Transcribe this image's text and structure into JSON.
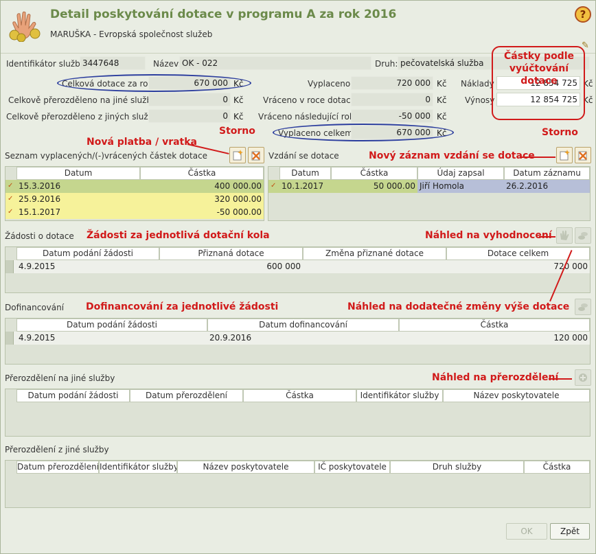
{
  "window": {
    "title": "Detail poskytování dotace v programu A za rok 2016",
    "subtitle": "MARUŠKA - Evropská společnost služeb",
    "help": "?"
  },
  "header_fields": {
    "id_label": "Identifikátor služby:",
    "id_value": "3447648",
    "name_label": "Název:",
    "name_value": "OK - 022",
    "type_label": "Druh:",
    "type_value": "pečovatelská služba"
  },
  "amounts": {
    "celkova_label": "Celková dotace za rok:",
    "celkova_value": "670 000",
    "prerozdeleno_label": "Celkově přerozděleno na jiné služby:",
    "prerozdeleno_value": "0",
    "prerozdeleno_z_label": "Celkově přerozděleno z jiných služeb:",
    "prerozdeleno_z_value": "0",
    "vyplaceno_label": "Vyplaceno:",
    "vyplaceno_value": "720 000",
    "vraceno_label": "Vráceno v roce dotace:",
    "vraceno_value": "0",
    "vraceno_nasl_label": "Vráceno následující rok:",
    "vraceno_nasl_value": "-50 000",
    "vyplaceno_celkem_label": "Vyplaceno celkem:",
    "vyplaceno_celkem_value": "670 000",
    "naklady_label": "Náklady",
    "naklady_value": "12 854 725",
    "vynosy_label": "Výnosy",
    "vynosy_value": "12 854 725",
    "currency": "Kč"
  },
  "annotations": {
    "castky": "Částky podle vyúčtování dotace",
    "nova_platba": "Nová platba / vratka",
    "storno1": "Storno",
    "storno2": "Storno",
    "novy_zaznam": "Nový záznam vzdání se dotace",
    "zadosti": "Žádosti za jednotlivá dotační kola",
    "nahled_vyhodnoceni": "Náhled na vyhodnocení",
    "dofinancovani": "Dofinancování za jednotlivé žádosti",
    "nahled_zmeny": "Náhled na dodatečné změny výše dotace",
    "nahled_prerozdeleni": "Náhled na přerozdělení"
  },
  "payments": {
    "title": "Seznam vyplacených/(-)vrácených částek dotace",
    "columns": [
      "Datum",
      "Částka"
    ],
    "rows": [
      {
        "date": "15.3.2016",
        "amount": "400 000.00"
      },
      {
        "date": "25.9.2016",
        "amount": "320 000.00"
      },
      {
        "date": "15.1.2017",
        "amount": "-50 000.00"
      }
    ]
  },
  "waivers": {
    "title": "Vzdání se dotace",
    "columns": [
      "Datum",
      "Částka",
      "Údaj zapsal",
      "Datum záznamu"
    ],
    "rows": [
      {
        "date": "10.1.2017",
        "amount": "50 000.00",
        "by": "Jiří Homola",
        "recorded": "26.2.2016"
      }
    ]
  },
  "requests": {
    "title": "Žádosti o dotace",
    "columns": [
      "Datum podání žádosti",
      "Přiznaná dotace",
      "Změna přiznané dotace",
      "Dotace celkem"
    ],
    "rows": [
      {
        "date": "4.9.2015",
        "granted": "600 000",
        "change": "",
        "total": "720 000"
      }
    ]
  },
  "cofinancing": {
    "title": "Dofinancování",
    "columns": [
      "Datum podání žádosti",
      "Datum dofinancování",
      "Částka"
    ],
    "rows": [
      {
        "date": "4.9.2015",
        "cofin_date": "20.9.2016",
        "amount": "120 000"
      }
    ]
  },
  "redist_to": {
    "title": "Přerozdělení na jiné služby",
    "columns": [
      "Datum podání žádosti",
      "Datum přerozdělení",
      "Částka",
      "Identifikátor služby",
      "Název poskytovatele"
    ]
  },
  "redist_from": {
    "title": "Přerozdělení z jiné služby",
    "columns": [
      "Datum přerozdělení",
      "Identifikátor služby",
      "Název poskytovatele",
      "IČ poskytovatele",
      "Druh služby",
      "Částka"
    ]
  },
  "buttons": {
    "ok": "OK",
    "back": "Zpět"
  }
}
